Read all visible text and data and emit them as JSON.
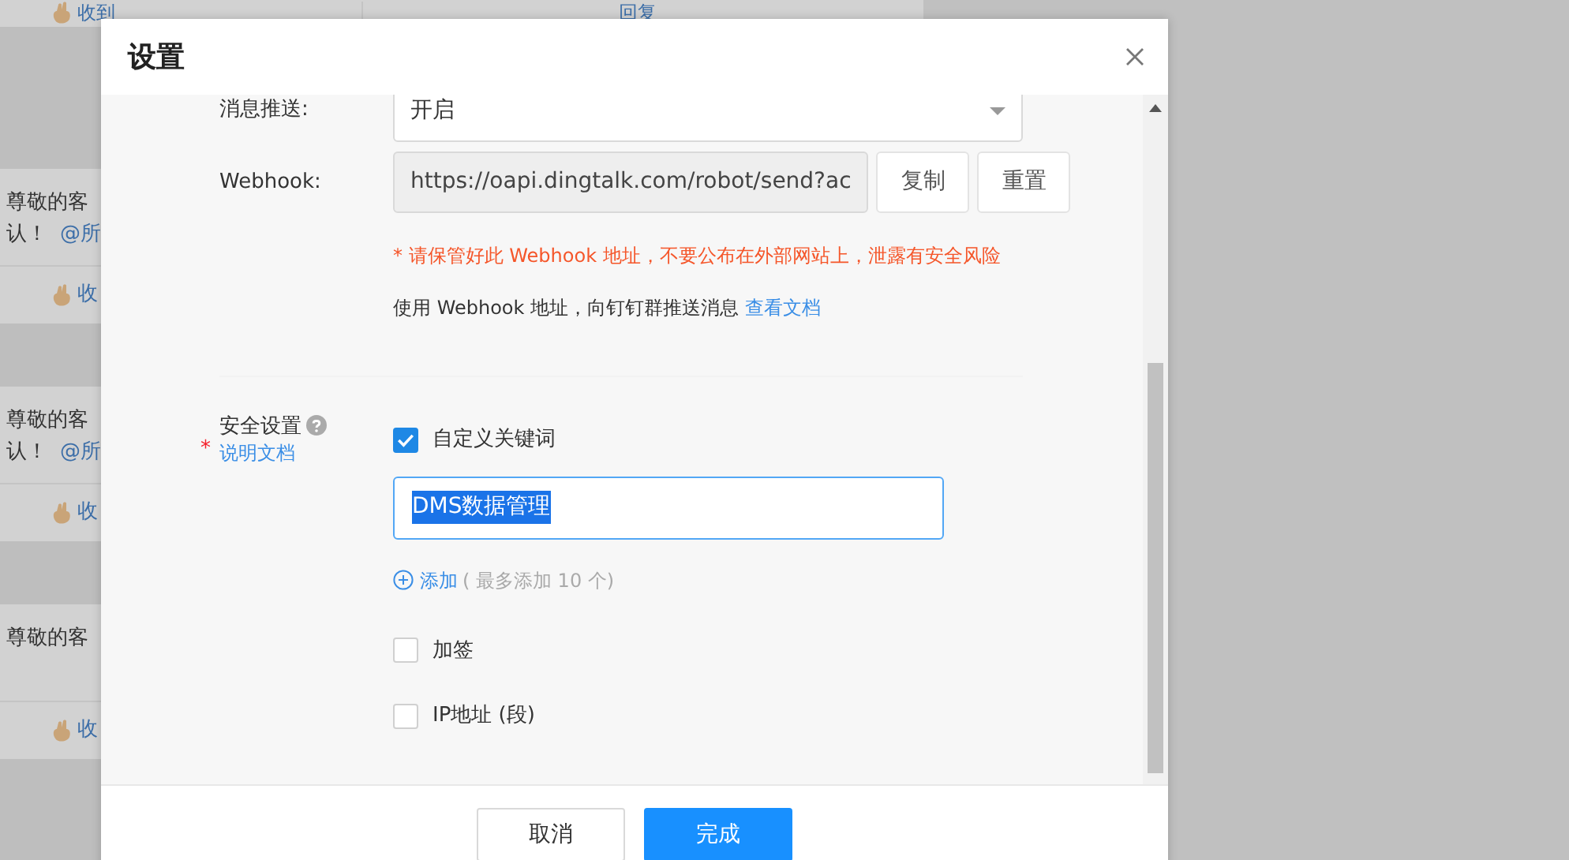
{
  "background": {
    "top_row": {
      "reaction": "收到",
      "reply": "回复"
    },
    "messages": [
      {
        "lines": [
          "尊敬的客",
          "认！"
        ],
        "mention": "@所",
        "reaction": "收"
      },
      {
        "lines": [
          "尊敬的客",
          "认！"
        ],
        "mention": "@所",
        "reaction": "收"
      },
      {
        "lines": [
          "尊敬的客"
        ],
        "reaction": "收"
      }
    ]
  },
  "dialog": {
    "title": "设置",
    "fields": [
      {
        "kind": "select",
        "label": "消息推送:",
        "value": "开启"
      },
      {
        "kind": "webhook",
        "label": "Webhook:",
        "value": "https://oapi.dingtalk.com/robot/send?ac",
        "buttons": [
          "复制",
          "重置"
        ],
        "warning": "* 请保管好此 Webhook 地址，不要公布在外部网站上，泄露有安全风险",
        "hint": "使用 Webhook 地址，向钉钉群推送消息",
        "hint_link": "查看文档"
      }
    ],
    "security": {
      "label": "安全设置",
      "required_mark": "*",
      "doc_link": "说明文档",
      "options": [
        {
          "label": "自定义关键词",
          "checked": true,
          "keywords": [
            "DMS数据管理"
          ],
          "add_label": "添加",
          "add_note": "( 最多添加 10 个)"
        },
        {
          "label": "加签",
          "checked": false
        },
        {
          "label": "IP地址 (段)",
          "checked": false
        }
      ]
    },
    "buttons": [
      {
        "label": "取消",
        "kind": "default"
      },
      {
        "label": "完成",
        "kind": "primary"
      }
    ]
  }
}
